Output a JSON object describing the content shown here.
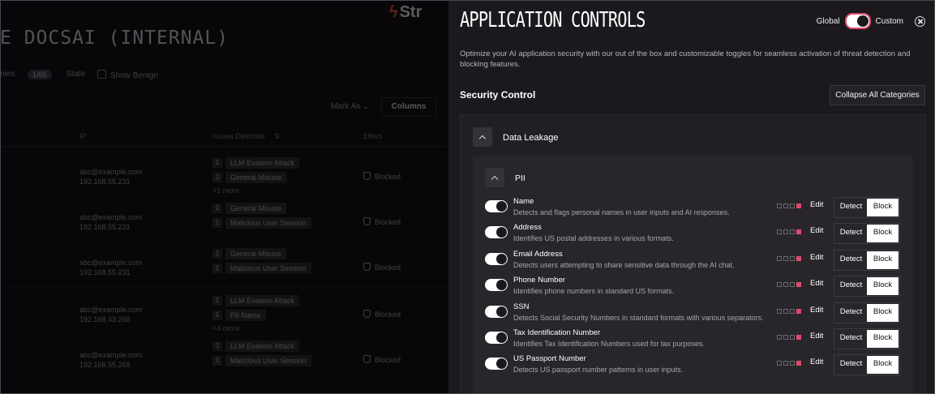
{
  "background_app": {
    "logo_text": "Str",
    "page_title": "E DOCSAI (INTERNAL)",
    "filter_label_partial": "nies",
    "filter_badge": "1/66",
    "state_label": "State",
    "show_benign_label": "Show Benign",
    "mark_as_label": "Mark As",
    "columns_label": "Columns",
    "table_headers": [
      "IP",
      "Issues Detected",
      "Effect"
    ],
    "rows": [
      {
        "email": "abc@example.com",
        "ip": "192.168.55.231",
        "tags": [
          {
            "n": "1",
            "t": "LLM Evasion Attack"
          },
          {
            "n": "1",
            "t": "General Misuse"
          }
        ],
        "more": "+1 more",
        "effect": "Blocked"
      },
      {
        "email": "abc@example.com",
        "ip": "192.168.55.231",
        "tags": [
          {
            "n": "1",
            "t": "General Misuse"
          },
          {
            "n": "1",
            "t": "Malicious User Session"
          }
        ],
        "more": "",
        "effect": "Blocked"
      },
      {
        "email": "abc@example.com",
        "ip": "192.168.55.231",
        "tags": [
          {
            "n": "1",
            "t": "General Misuse"
          },
          {
            "n": "1",
            "t": "Malicious User Session"
          }
        ],
        "more": "",
        "effect": "Blocked"
      },
      {
        "email": "abc@example.com",
        "ip": "192.168.43.268",
        "tags": [
          {
            "n": "1",
            "t": "LLM Evasion Attack"
          },
          {
            "n": "1",
            "t": "PII Name"
          }
        ],
        "more": "+4 more",
        "effect": "Blocked"
      },
      {
        "email": "abc@example.com",
        "ip": "192.168.55.268",
        "tags": [
          {
            "n": "1",
            "t": "LLM Evasion Attack"
          },
          {
            "n": "1",
            "t": "Malicious User Session"
          }
        ],
        "more": "",
        "effect": "Blocked"
      }
    ]
  },
  "drawer": {
    "title": "APPLICATION CONTROLS",
    "toggle_left": "Global",
    "toggle_right": "Custom",
    "description": "Optimize your AI application security with our out of the box and customizable toggles for seamless activation of threat detection and blocking features.",
    "section_label": "Security Control",
    "collapse_button": "Collapse All Categories",
    "category": "Data Leakage",
    "subcategory": "PII",
    "edit_label": "Edit",
    "detect_label": "Detect",
    "block_label": "Block",
    "items": [
      {
        "name": "Name",
        "desc": "Detects and flags personal names in user inputs and AI responses."
      },
      {
        "name": "Address",
        "desc": "Identifies US postal addresses in various formats."
      },
      {
        "name": "Email Address",
        "desc": "Detects users attempting to share sensitive data through the AI chat."
      },
      {
        "name": "Phone Number",
        "desc": "Identifies phone numbers in standard US formats."
      },
      {
        "name": "SSN",
        "desc": "Detects Social Security Numbers in standard formats with various separators."
      },
      {
        "name": "Tax Identification Number",
        "desc": "Identifies Tax Identification Numbers used for tax purposes."
      },
      {
        "name": "US Passport Number",
        "desc": "Detects US passport number patterns in user inputs."
      }
    ]
  }
}
